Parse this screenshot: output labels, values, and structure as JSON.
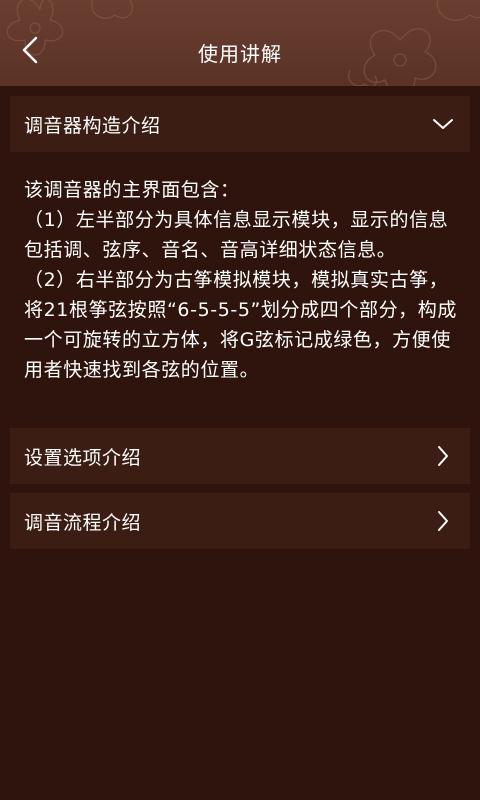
{
  "header": {
    "title": "使用讲解",
    "back_icon": "chevron-left-icon"
  },
  "sections": [
    {
      "label": "调音器构造介绍",
      "expanded": true,
      "icon": "chevron-down-icon"
    },
    {
      "label": "设置选项介绍",
      "expanded": false,
      "icon": "chevron-right-icon"
    },
    {
      "label": "调音流程介绍",
      "expanded": false,
      "icon": "chevron-right-icon"
    }
  ],
  "content": {
    "intro": "该调音器的主界面包含：",
    "item1": "（1）左半部分为具体信息显示模块，显示的信息包括调、弦序、音名、音高详细状态信息。",
    "item2": "（2）右半部分为古筝模拟模块，模拟真实古筝，将21根筝弦按照“6-5-5-5”划分成四个部分，构成一个可旋转的立方体，将G弦标记成绿色，方便使用者快速找到各弦的位置。"
  },
  "colors": {
    "background": "#2e140d",
    "header": "#6a3f31",
    "section_bar": "#3b1d14",
    "text": "#ffffff"
  }
}
